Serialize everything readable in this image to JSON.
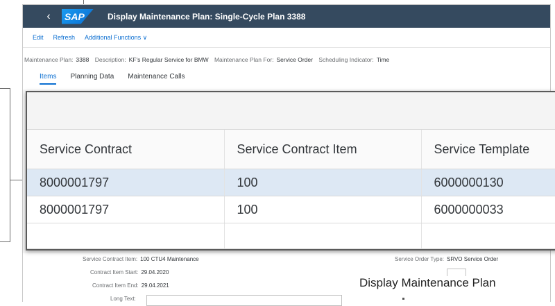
{
  "app": {
    "title": "Display Maintenance Plan: Single-Cycle Plan 3388",
    "logo": "SAP",
    "back_icon": "chevron-left-icon"
  },
  "toolbar": {
    "edit": "Edit",
    "refresh": "Refresh",
    "additional": "Additional Functions ∨"
  },
  "header": {
    "plan_label": "Maintenance Plan:",
    "plan_value": "3388",
    "desc_label": "Description:",
    "desc_value": "KF's Regular Service for BMW",
    "for_label": "Maintenance Plan For:",
    "for_value": "Service Order",
    "sched_label": "Scheduling Indicator:",
    "sched_value": "Time"
  },
  "tabs": [
    {
      "label": "Items",
      "active": true
    },
    {
      "label": "Planning Data",
      "active": false
    },
    {
      "label": "Maintenance Calls",
      "active": false
    }
  ],
  "table": {
    "columns": [
      "Service Contract",
      "Service Contract Item",
      "Service Template"
    ],
    "rows": [
      [
        "8000001797",
        "100",
        "6000000130"
      ],
      [
        "8000001797",
        "100",
        "6000000033"
      ]
    ]
  },
  "form": {
    "contract_item_label": "Service Contract Item:",
    "contract_item_value": "100 CTU4 Maintenance",
    "start_label": "Contract Item Start:",
    "start_value": "29.04.2020",
    "end_label": "Contract Item End:",
    "end_value": "29.04.2021",
    "longtext_label": "Long Text:",
    "order_type_label": "Service Order Type:",
    "order_type_value": "SRVO Service Order"
  },
  "caption": "Display Maintenance Plan",
  "colors": {
    "shell": "#354a5f",
    "link": "#0a6ed1",
    "selected_row": "#dde8f4"
  }
}
